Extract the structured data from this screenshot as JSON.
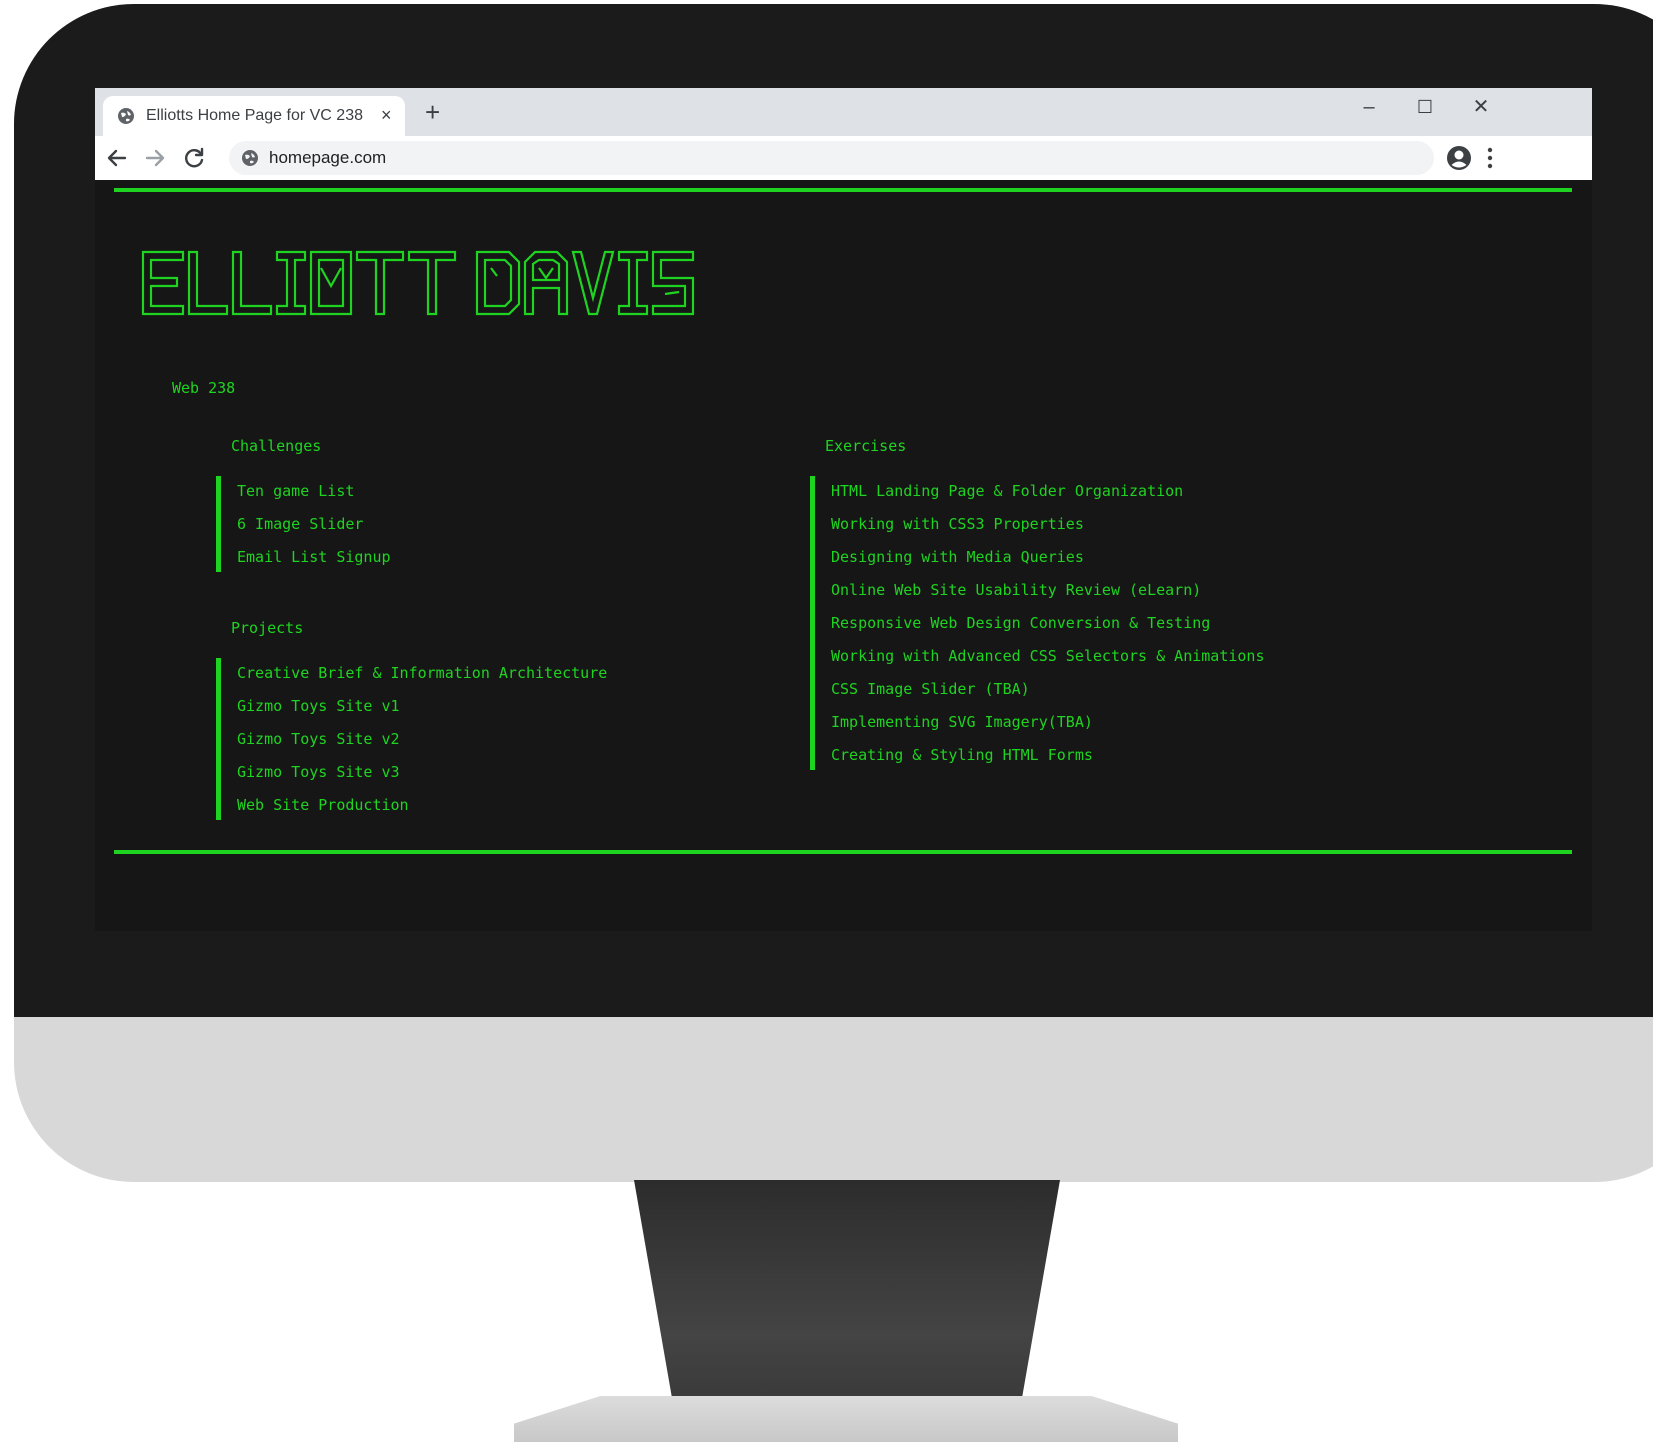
{
  "browser": {
    "tab_title": "Elliotts Home Page for VC 238",
    "tab_close": "×",
    "new_tab": "+",
    "url": "homepage.com",
    "window_controls": {
      "minimize": "–",
      "maximize": "☐",
      "close": "✕"
    }
  },
  "page": {
    "heading_art_text": "ELLIOTT DAVIS",
    "course": "Web 238",
    "challenges": {
      "heading": "Challenges",
      "items": [
        "Ten game List",
        "6 Image Slider",
        "Email List Signup"
      ]
    },
    "projects": {
      "heading": "Projects",
      "items": [
        "Creative Brief & Information Architecture",
        "Gizmo Toys Site v1",
        "Gizmo Toys Site v2",
        "Gizmo Toys Site v3",
        "Web Site Production"
      ]
    },
    "exercises": {
      "heading": "Exercises",
      "items": [
        "HTML Landing Page & Folder Organization",
        "Working with CSS3 Properties",
        "Designing with Media Queries",
        "Online Web Site Usability Review (eLearn)",
        "Responsive Web Design Conversion & Testing",
        "Working with Advanced CSS Selectors & Animations",
        "CSS Image Slider (TBA)",
        "Implementing SVG Imagery(TBA)",
        "Creating & Styling HTML Forms"
      ]
    }
  },
  "colors": {
    "accent": "#1fd421",
    "page_background": "#161616",
    "bezel": "#1b1b1b",
    "monitor_chin": "#d8d8d8"
  },
  "icons": {
    "favicon": "globe-icon",
    "back": "arrow-left-icon",
    "forward": "arrow-right-icon",
    "reload": "reload-icon",
    "site_info": "globe-icon",
    "profile": "account-circle-icon",
    "menu": "vertical-dots-icon"
  }
}
